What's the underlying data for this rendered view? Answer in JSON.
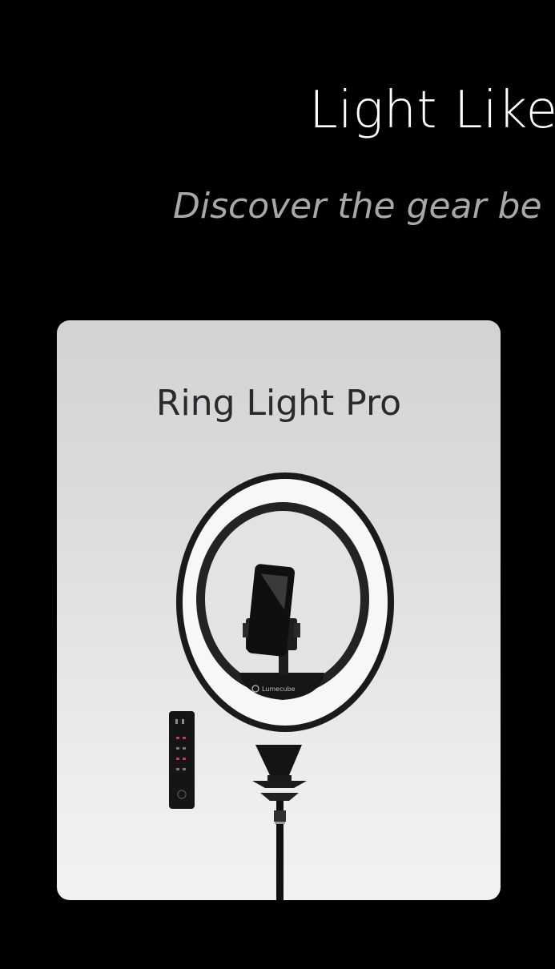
{
  "hero": {
    "title": "Light Like",
    "subtitle": "Discover the gear be"
  },
  "product_card": {
    "name": "Ring Light Pro",
    "image_icon": "ring-light-with-phone-holder-and-remote",
    "brand_mark": "Lumecube"
  },
  "colors": {
    "page_background": "#000000",
    "title": "#ffffff",
    "subtitle": "#a8a8a8",
    "card_background_top": "#d2d3d5",
    "card_background_bottom": "#f2f2f2",
    "product_name": "#2a2a2a"
  }
}
